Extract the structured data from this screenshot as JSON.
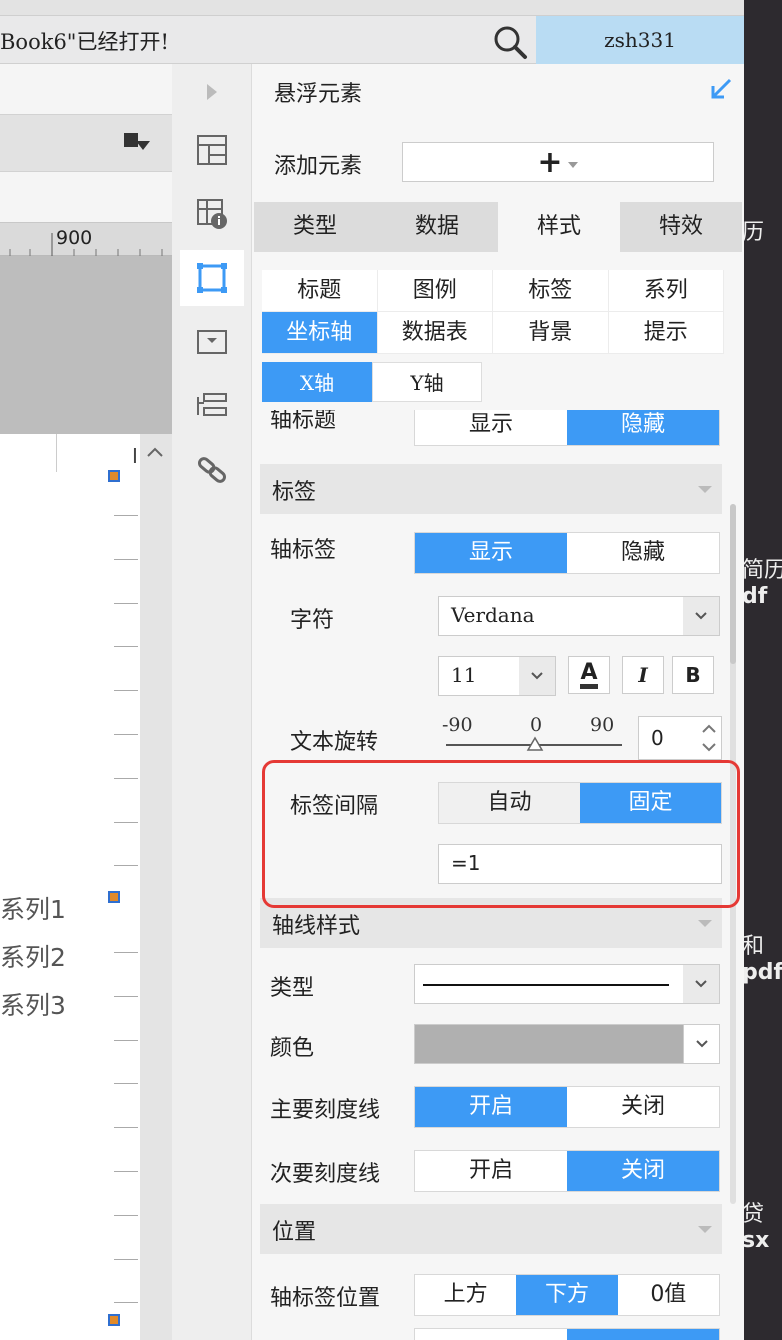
{
  "window": {
    "message": "Book6\"已经打开!",
    "user": "zsh331"
  },
  "desktop": {
    "labels": [
      "历",
      "简历",
      "df",
      "和",
      "pdf",
      "贷",
      "sx"
    ]
  },
  "workspace": {
    "ruler_label": "900",
    "series": [
      "系列1",
      "系列2",
      "系列3"
    ]
  },
  "panel": {
    "title": "悬浮元素",
    "add_label": "添加元素",
    "add_symbol": "+",
    "main_tabs": [
      "类型",
      "数据",
      "样式",
      "特效"
    ],
    "sub_tabs": [
      "标题",
      "图例",
      "标签",
      "系列",
      "坐标轴",
      "数据表",
      "背景",
      "提示"
    ],
    "axis_tabs": [
      "X轴",
      "Y轴"
    ],
    "axis_title_row": {
      "label": "轴标题",
      "options": [
        "显示",
        "隐藏"
      ]
    },
    "label_section": "标签",
    "axis_label_row": {
      "label": "轴标签",
      "options": [
        "显示",
        "隐藏"
      ]
    },
    "font_row": {
      "label": "字符",
      "value": "Verdana"
    },
    "size_value": "11",
    "format_buttons": [
      "A",
      "I",
      "B"
    ],
    "rotate_row": {
      "label": "文本旋转",
      "min": "-90",
      "mid": "0",
      "max": "90",
      "value": "0"
    },
    "interval_row": {
      "label": "标签间隔",
      "options": [
        "自动",
        "固定"
      ],
      "value": "=1"
    },
    "axis_style_section": "轴线样式",
    "type_row": {
      "label": "类型"
    },
    "color_row": {
      "label": "颜色",
      "color": "#b0b0b0"
    },
    "major_tick_row": {
      "label": "主要刻度线",
      "options": [
        "开启",
        "关闭"
      ]
    },
    "minor_tick_row": {
      "label": "次要刻度线",
      "options": [
        "开启",
        "关闭"
      ]
    },
    "position_section": "位置",
    "label_pos_row": {
      "label": "轴标签位置",
      "options": [
        "上方",
        "下方",
        "0值"
      ]
    }
  },
  "colors": {
    "accent": "#3d9af5",
    "highlight": "#e53935"
  }
}
